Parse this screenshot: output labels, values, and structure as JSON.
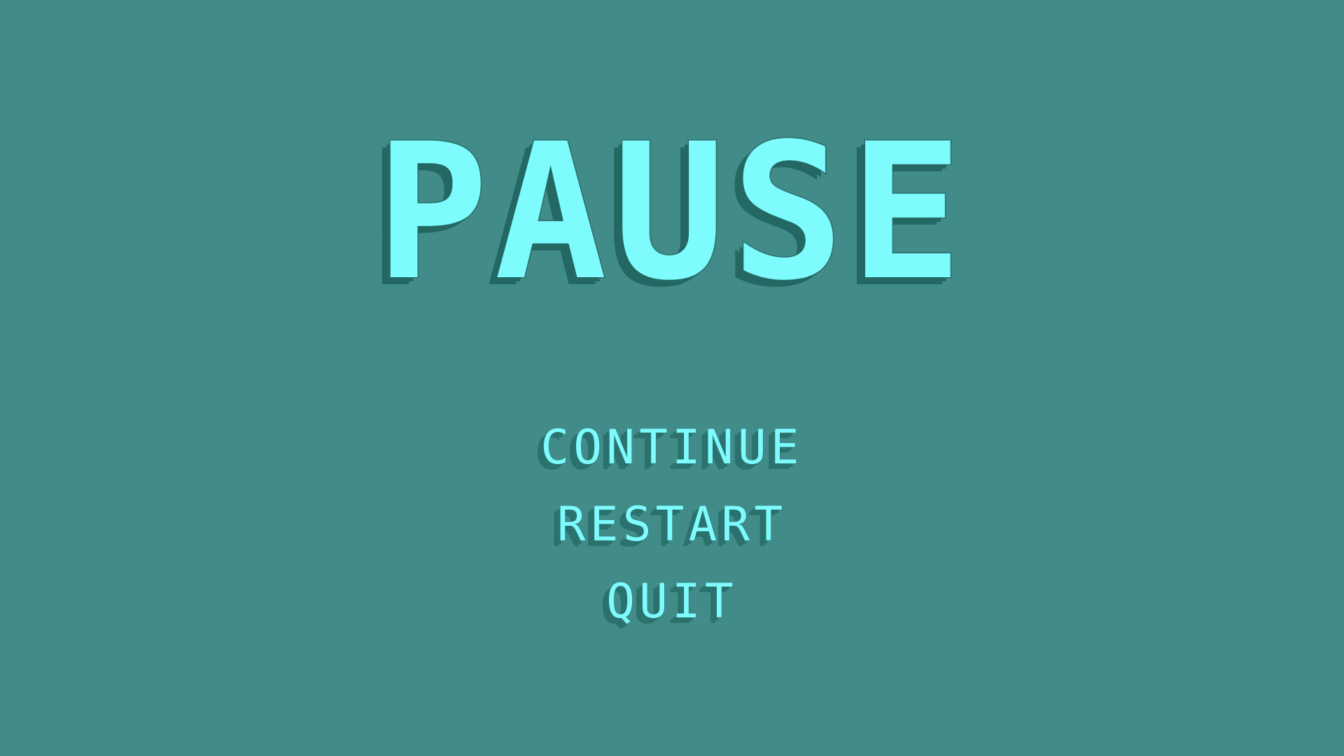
{
  "pause_menu": {
    "title": "PAUSE",
    "items": [
      {
        "label": "CONTINUE"
      },
      {
        "label": "RESTART"
      },
      {
        "label": "QUIT"
      }
    ]
  },
  "colors": {
    "background": "#418b89",
    "text": "#7dfbfd",
    "shadow": "#246864"
  }
}
